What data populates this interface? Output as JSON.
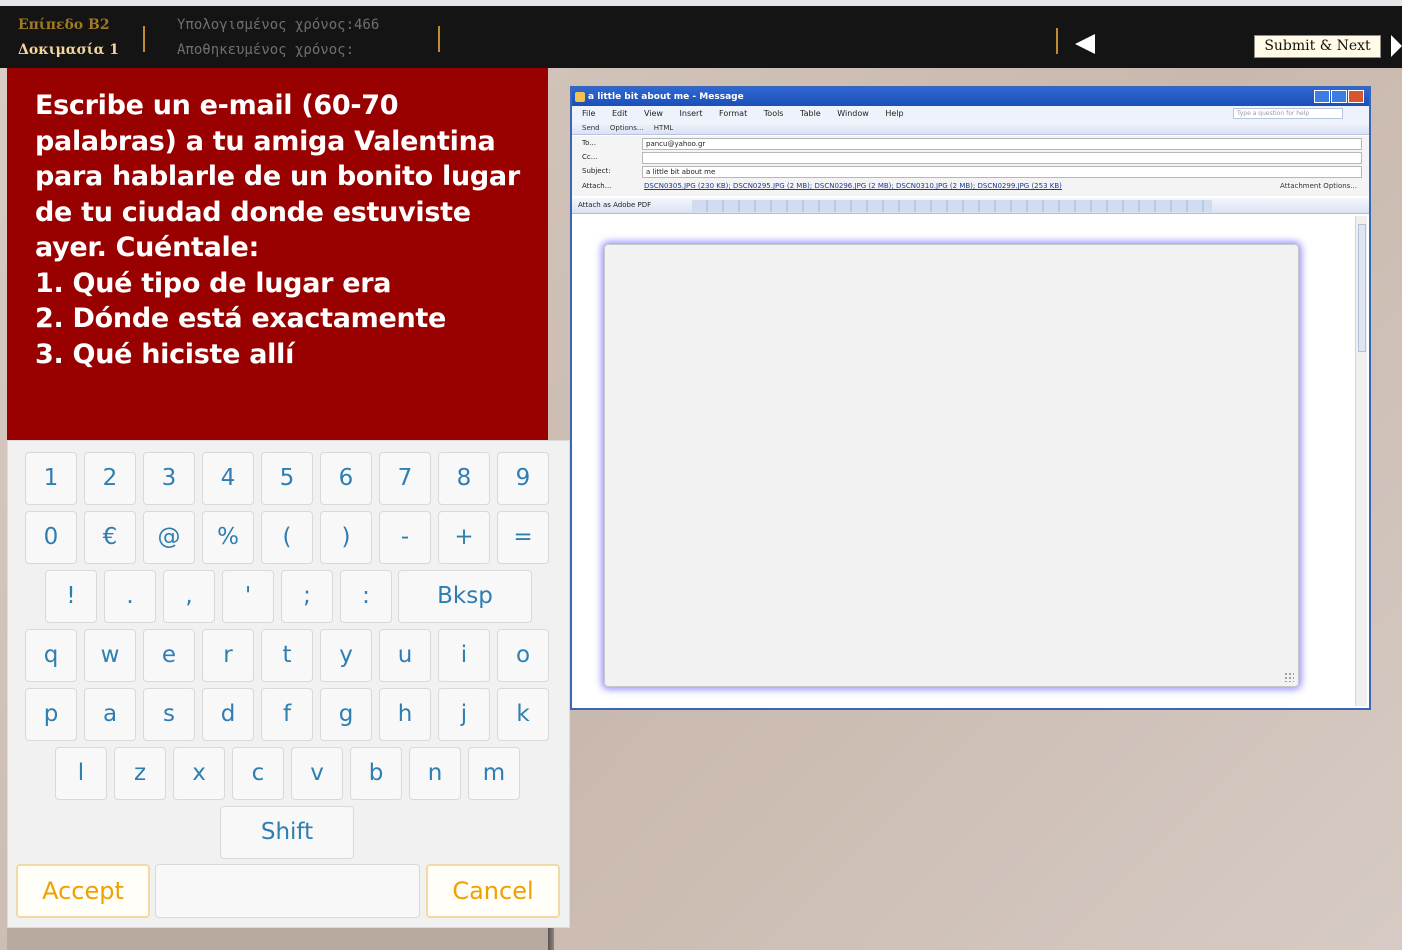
{
  "topbar": {
    "level": "Επίπεδο Β2",
    "test": "Δοκιμασία 1",
    "computed_time": "Υπολογισμένος χρόνος:466",
    "saved_time": "Αποθηκευμένος χρόνος:",
    "submit_label": "Submit & Next",
    "colors": {
      "bar": "#141414",
      "level": "#a07a1f",
      "test": "#f3d59b",
      "separator": "#c7892f"
    }
  },
  "question": {
    "prompt": "Escribe un e-mail (60-70 palabras) a tu amiga Valentina para hablarle de un bonito lugar de tu ciudad donde estuviste ayer. Cuéntale:",
    "items": [
      "1. Qué tipo de lugar era",
      "2. Dónde está exactamente",
      "3. Qué hiciste allí"
    ],
    "color": "#990000"
  },
  "keyboard": {
    "rows": [
      [
        "1",
        "2",
        "3",
        "4",
        "5",
        "6",
        "7",
        "8",
        "9"
      ],
      [
        "0",
        "€",
        "@",
        "%",
        "(",
        ")",
        "-",
        "+",
        "="
      ],
      [
        "!",
        ".",
        ",",
        "'",
        ";",
        ":",
        "Bksp"
      ],
      [
        "q",
        "w",
        "e",
        "r",
        "t",
        "y",
        "u",
        "i",
        "o"
      ],
      [
        "p",
        "a",
        "s",
        "d",
        "f",
        "g",
        "h",
        "j",
        "k"
      ],
      [
        "l",
        "z",
        "x",
        "c",
        "v",
        "b",
        "n",
        "m"
      ],
      [
        "Shift"
      ]
    ],
    "accept_label": "Accept",
    "cancel_label": "Cancel",
    "space_label": "",
    "colors": {
      "key_text": "#2f7eb2",
      "action_text": "#f0a000"
    }
  },
  "image": {
    "title": "a little bit about me - Message",
    "menu": [
      "File",
      "Edit",
      "View",
      "Insert",
      "Format",
      "Tools",
      "Table",
      "Window",
      "Help"
    ],
    "help_placeholder": "Type a question for help",
    "toolbar": [
      "Send",
      "Options...",
      "HTML"
    ],
    "fields": {
      "to_label": "To...",
      "to_value": "pancu@yahoo.gr",
      "cc_label": "Cc...",
      "cc_value": "",
      "subject_label": "Subject:",
      "subject_value": "a little bit about me",
      "attach_label": "Attach...",
      "attachments": [
        "DSCN0305.JPG (230 KB)",
        "DSCN0295.JPG (2 MB)",
        "DSCN0296.JPG (2 MB)",
        "DSCN0310.JPG (2 MB)",
        "DSCN0299.JPG (253 KB)"
      ],
      "attach_options": "Attachment Options..."
    },
    "format_bar_label": "Attach as Adobe PDF"
  }
}
